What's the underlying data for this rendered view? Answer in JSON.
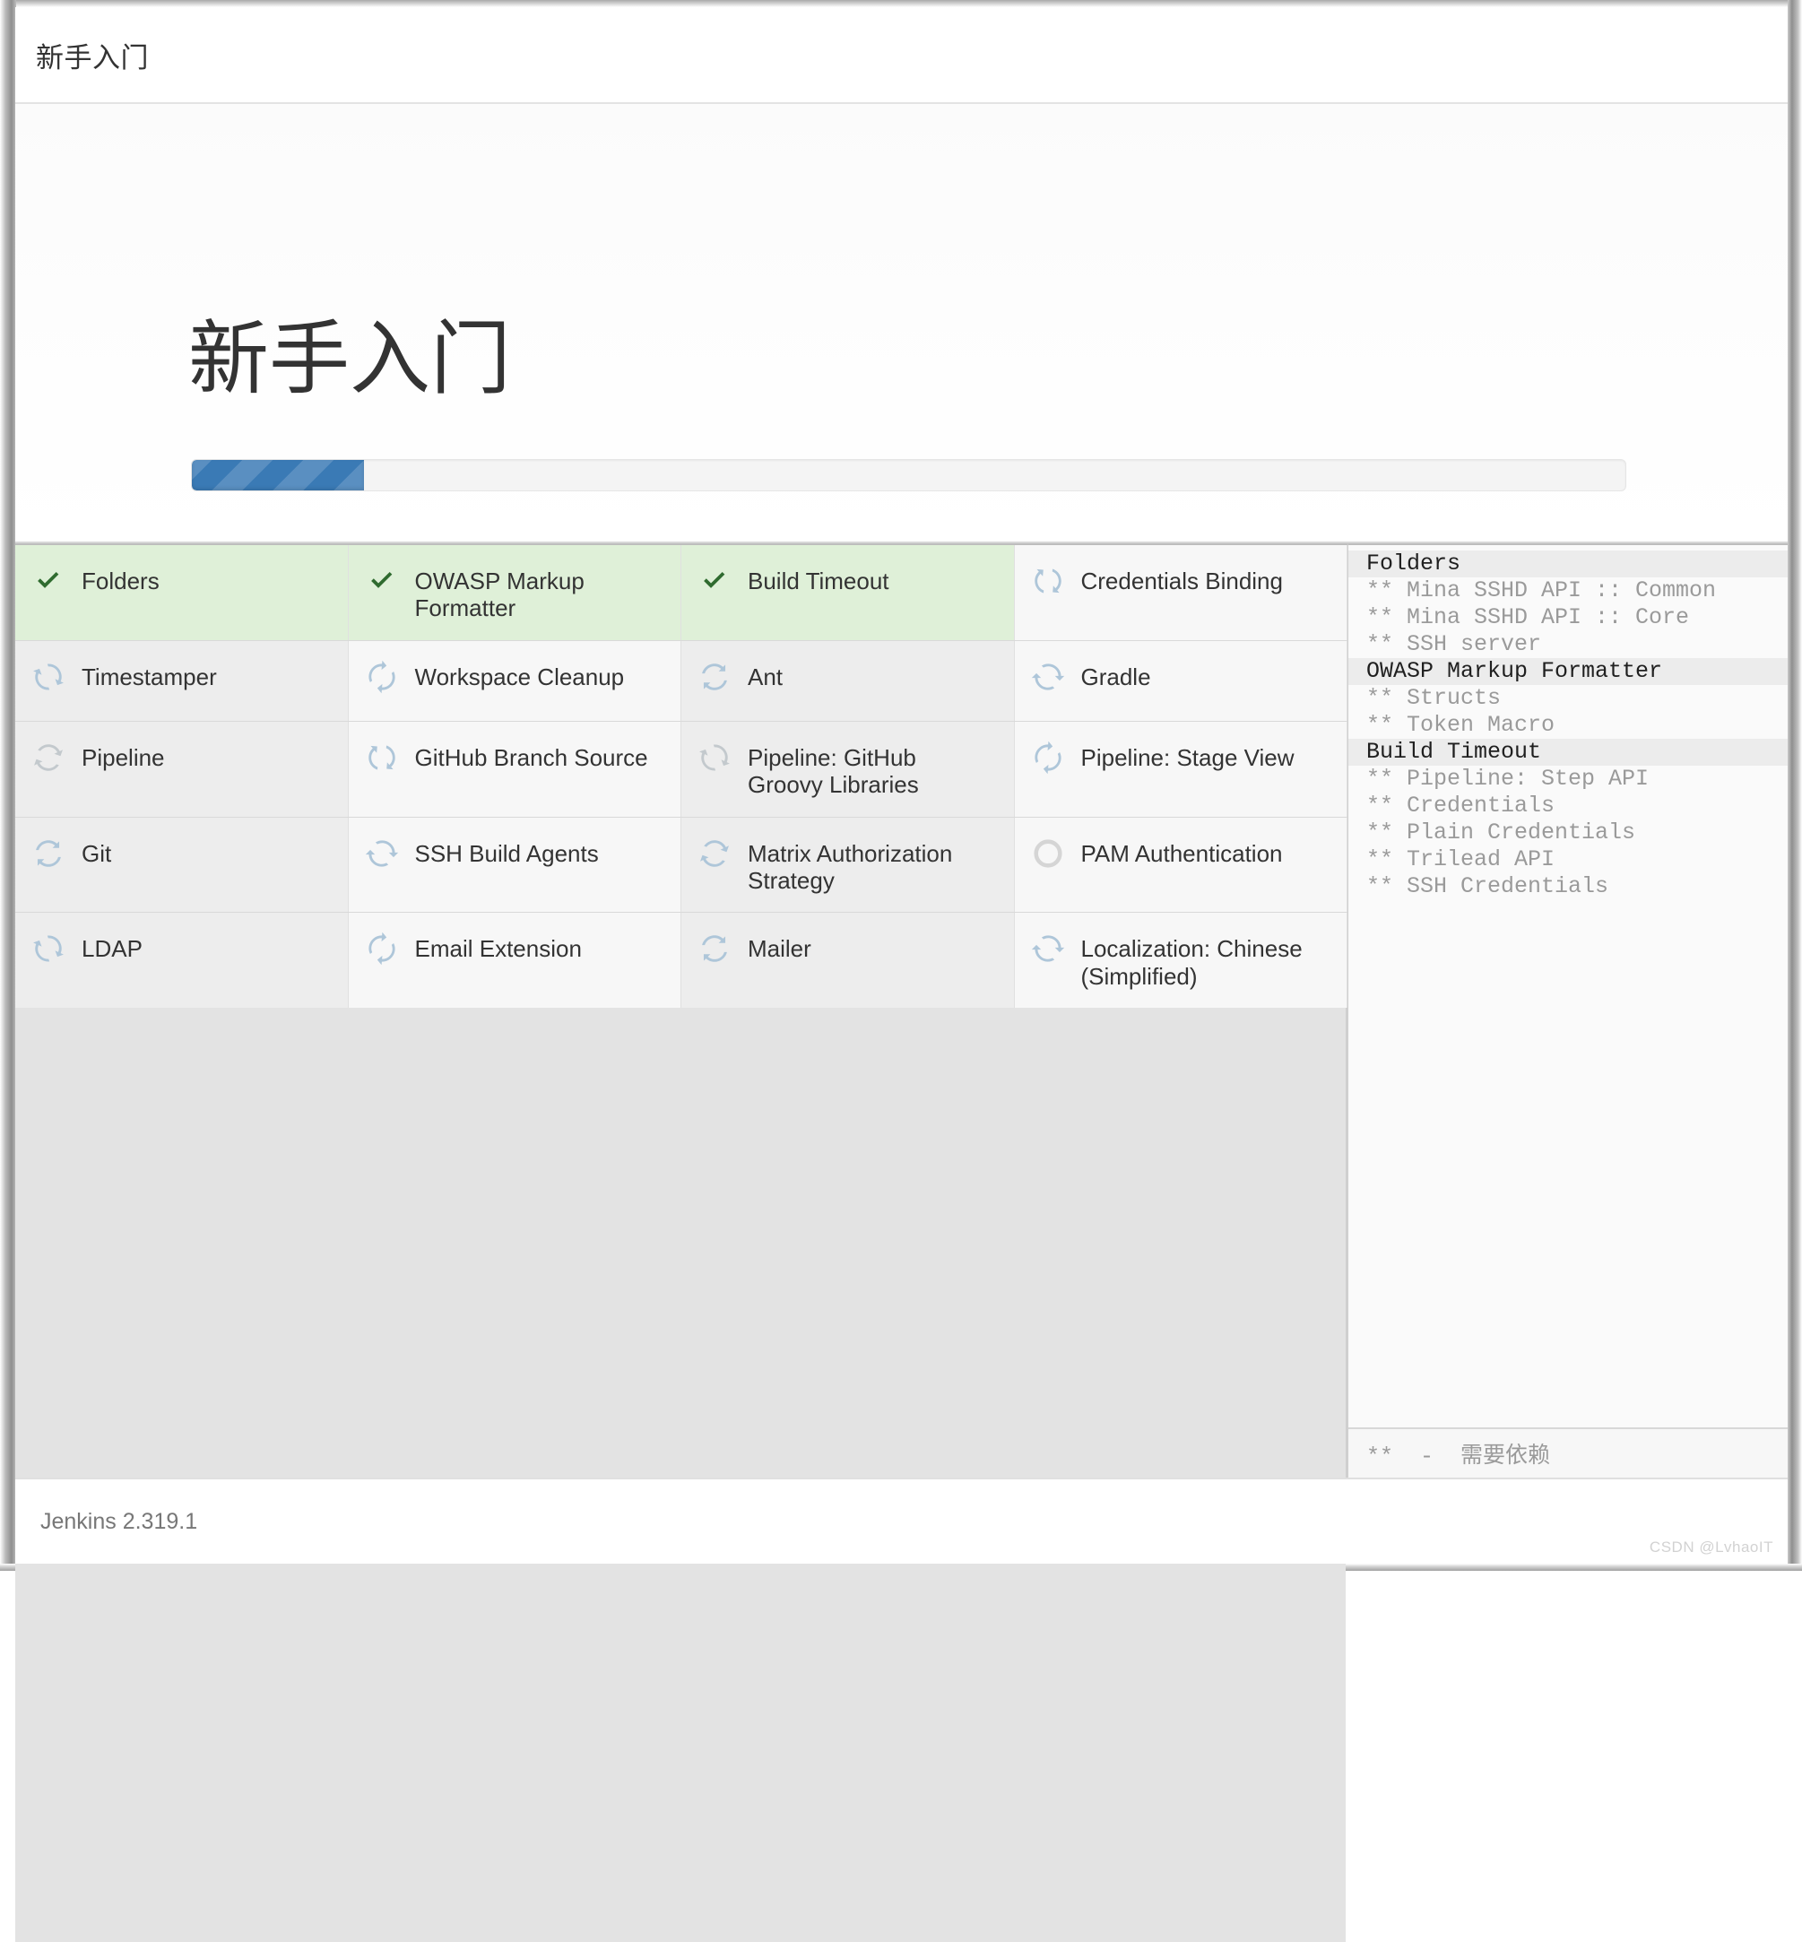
{
  "window": {
    "bar_title": "新手入门"
  },
  "hero": {
    "title": "新手入门",
    "progress_percent": 12,
    "progress_fill_color": "#3a7ab5",
    "progress_track_color": "#f4f4f4"
  },
  "plugins": {
    "status_colors": {
      "done": "#dff0d8",
      "check": "#2f6b2f",
      "spinner_blue": "#aec6d9",
      "spinner_gray": "#c3c9cd",
      "pending_circle": "#d5d5d5"
    },
    "cells": [
      {
        "label": "Folders",
        "status": "done",
        "icon": "check-icon",
        "col": 1
      },
      {
        "label": "OWASP Markup Formatter",
        "status": "done",
        "icon": "check-icon",
        "col": 2
      },
      {
        "label": "Build Timeout",
        "status": "done",
        "icon": "check-icon",
        "col": 3
      },
      {
        "label": "Credentials Binding",
        "status": "installing",
        "icon": "spinner-icon",
        "col": 4
      },
      {
        "label": "Timestamper",
        "status": "installing",
        "icon": "spinner-icon",
        "col": 1
      },
      {
        "label": "Workspace Cleanup",
        "status": "installing",
        "icon": "spinner-icon",
        "col": 2
      },
      {
        "label": "Ant",
        "status": "installing",
        "icon": "spinner-icon",
        "col": 3
      },
      {
        "label": "Gradle",
        "status": "installing",
        "icon": "spinner-icon",
        "col": 4
      },
      {
        "label": "Pipeline",
        "status": "in-progress",
        "icon": "spinner-icon",
        "col": 1
      },
      {
        "label": "GitHub Branch Source",
        "status": "installing",
        "icon": "spinner-icon",
        "col": 2
      },
      {
        "label": "Pipeline: GitHub Groovy Libraries",
        "status": "in-progress",
        "icon": "spinner-icon",
        "col": 3
      },
      {
        "label": "Pipeline: Stage View",
        "status": "installing",
        "icon": "spinner-icon",
        "col": 4
      },
      {
        "label": "Git",
        "status": "installing",
        "icon": "spinner-icon",
        "col": 1
      },
      {
        "label": "SSH Build Agents",
        "status": "installing",
        "icon": "spinner-icon",
        "col": 2
      },
      {
        "label": "Matrix Authorization Strategy",
        "status": "installing",
        "icon": "spinner-icon",
        "col": 3
      },
      {
        "label": "PAM Authentication",
        "status": "pending",
        "icon": "empty-circle-icon",
        "col": 4
      },
      {
        "label": "LDAP",
        "status": "installing",
        "icon": "spinner-icon",
        "col": 1
      },
      {
        "label": "Email Extension",
        "status": "installing",
        "icon": "spinner-icon",
        "col": 2
      },
      {
        "label": "Mailer",
        "status": "installing",
        "icon": "spinner-icon",
        "col": 3
      },
      {
        "label": "Localization: Chinese (Simplified)",
        "status": "installing",
        "icon": "spinner-icon",
        "col": 4
      }
    ]
  },
  "log": {
    "lines": [
      {
        "text": "Folders",
        "type": "main"
      },
      {
        "text": "** Mina SSHD API :: Common",
        "type": "dep"
      },
      {
        "text": "** Mina SSHD API :: Core",
        "type": "dep"
      },
      {
        "text": "** SSH server",
        "type": "dep"
      },
      {
        "text": "OWASP Markup Formatter",
        "type": "main"
      },
      {
        "text": "** Structs",
        "type": "dep"
      },
      {
        "text": "** Token Macro",
        "type": "dep"
      },
      {
        "text": "Build Timeout",
        "type": "main"
      },
      {
        "text": "** Pipeline: Step API",
        "type": "dep"
      },
      {
        "text": "** Credentials",
        "type": "dep"
      },
      {
        "text": "** Plain Credentials",
        "type": "dep"
      },
      {
        "text": "** Trilead API",
        "type": "dep"
      },
      {
        "text": "** SSH Credentials",
        "type": "dep"
      }
    ],
    "legend": "**  -  需要依赖"
  },
  "footer": {
    "version": "Jenkins 2.319.1",
    "watermark": "CSDN @LvhaoIT"
  }
}
